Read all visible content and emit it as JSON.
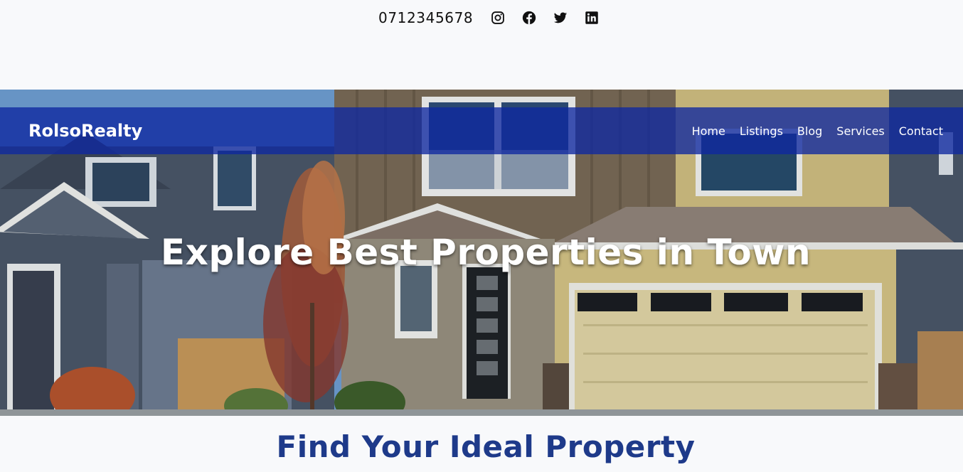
{
  "topbar": {
    "phone": "0712345678",
    "social": [
      {
        "icon": "instagram-icon"
      },
      {
        "icon": "facebook-icon"
      },
      {
        "icon": "twitter-icon"
      },
      {
        "icon": "linkedin-icon"
      }
    ]
  },
  "navbar": {
    "brand": "RolsoRealty",
    "links": [
      "Home",
      "Listings",
      "Blog",
      "Services",
      "Contact"
    ],
    "background": "#0e28a0"
  },
  "hero": {
    "title": "Explore Best Properties in Town",
    "image": "house-photo"
  },
  "section": {
    "title": "Find Your Ideal Property",
    "title_color": "#1e3a8a"
  }
}
